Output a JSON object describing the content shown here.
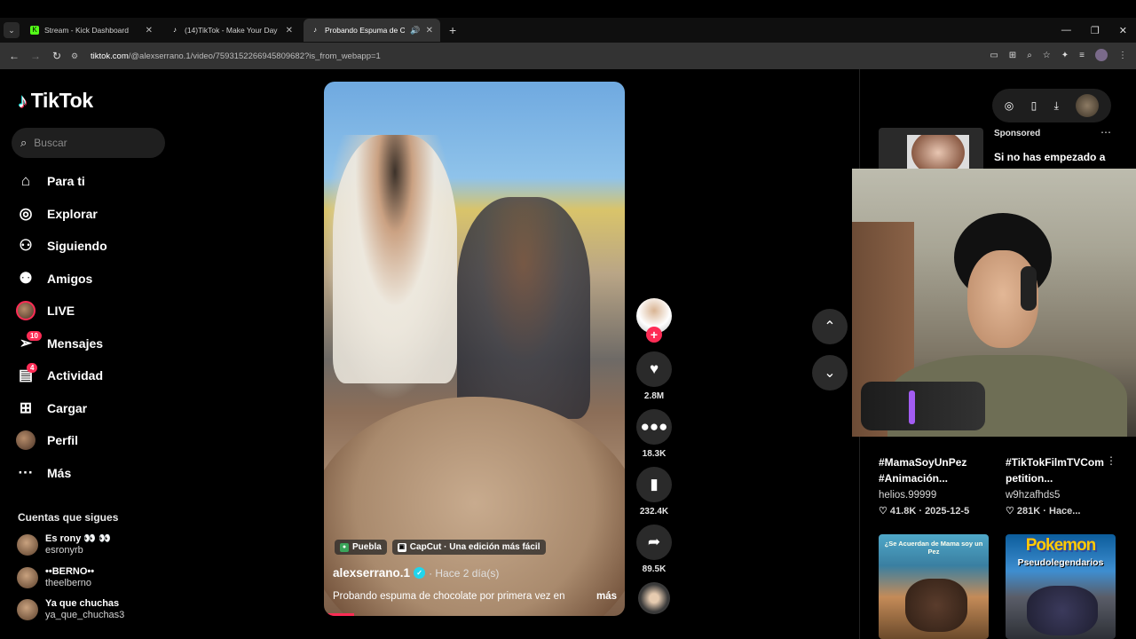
{
  "browser": {
    "tabs": [
      {
        "title": "Stream - Kick Dashboard",
        "favicon": "kick-icon",
        "active": false
      },
      {
        "title": "(14)TikTok - Make Your Day",
        "favicon": "tiktok-icon",
        "active": false
      },
      {
        "title": "Probando Espuma de Choc",
        "favicon": "tiktok-icon",
        "active": true
      }
    ],
    "url_host": "tiktok.com",
    "url_path": "/@alexserrano.1/video/7593152266945809682?is_from_webapp=1"
  },
  "sidebar": {
    "logo": "TikTok",
    "search_placeholder": "Buscar",
    "nav": [
      {
        "label": "Para ti",
        "icon": "home-icon"
      },
      {
        "label": "Explorar",
        "icon": "compass-icon"
      },
      {
        "label": "Siguiendo",
        "icon": "user-follow-icon"
      },
      {
        "label": "Amigos",
        "icon": "friends-icon"
      },
      {
        "label": "LIVE",
        "icon": "live-avatar"
      },
      {
        "label": "Mensajes",
        "icon": "messages-icon",
        "badge": "10"
      },
      {
        "label": "Actividad",
        "icon": "activity-icon",
        "badge": "4"
      },
      {
        "label": "Cargar",
        "icon": "upload-icon"
      },
      {
        "label": "Perfil",
        "icon": "profile-avatar"
      },
      {
        "label": "Más",
        "icon": "more-icon"
      }
    ],
    "following_title": "Cuentas que sigues",
    "following": [
      {
        "name": "Es rony 👀 👀",
        "user": "esronyrb"
      },
      {
        "name": "••BERNO••",
        "user": "theelberno"
      },
      {
        "name": "Ya que chuchas",
        "user": "ya_que_chuchas3"
      }
    ]
  },
  "video": {
    "tags": [
      "Puebla",
      "CapCut · Una edición más fácil"
    ],
    "author": "alexserrano.1",
    "time": "· Hace 2 día(s)",
    "description": "Probando espuma de chocolate por primera vez en",
    "more": "más",
    "progress": 0.1
  },
  "actions": {
    "likes": "2.8M",
    "comments": "18.3K",
    "saves": "232.4K",
    "shares": "89.5K"
  },
  "right": {
    "sponsored_label": "Sponsored",
    "sponsored_title": "Si no has empezado a",
    "cards": [
      {
        "title1": "#MamaSoyUnPez",
        "title2": "#Animación...",
        "user": "helios.99999",
        "likes": "♡ 41.8K",
        "date": "· 2025-12-5"
      },
      {
        "title1": "#TikTokFilmTVCom",
        "title2": "petition...",
        "user": "w9hzafhds5",
        "likes": "♡ 281K",
        "date": "· Hace..."
      }
    ],
    "thumb1_text": "¿Se Acuerdan de Mama soy un Pez",
    "thumb2_title": "Pokemon",
    "thumb2_sub": "Pseudolegendarios"
  },
  "colors": {
    "accent": "#fe2c55",
    "verified": "#20d5ec"
  }
}
